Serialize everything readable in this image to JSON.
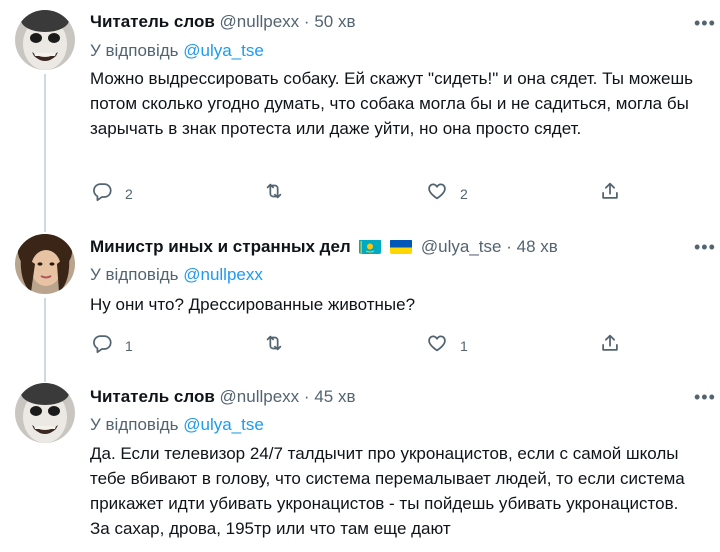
{
  "colors": {
    "link": "#1d9bf0",
    "secondary": "#536471",
    "text": "#0f1419",
    "thread_line": "#cfd9de"
  },
  "tweets": [
    {
      "name": "Читатель слов",
      "handle": "@nullpexx",
      "separator": "·",
      "time": "50 хв",
      "reply_prefix": "У відповідь",
      "reply_to": "@ulya_tse",
      "text": "Можно выдрессировать собаку. Ей скажут \"сидеть!\" и она сядет. Ты можешь потом сколько угодно думать, что собака могла бы и не садиться, могла бы зарычать в знак протеста или даже уйти, но она просто сядет.",
      "replies": "2",
      "retweets": "",
      "likes": "2"
    },
    {
      "name": "Министр иных и странных дел",
      "flags": [
        "kazakhstan-flag",
        "ukraine-flag"
      ],
      "handle": "@ulya_tse",
      "separator": "·",
      "time": "48 хв",
      "reply_prefix": "У відповідь",
      "reply_to": "@nullpexx",
      "text": "Ну они что? Дрессированные животные?",
      "replies": "1",
      "retweets": "",
      "likes": "1"
    },
    {
      "name": "Читатель слов",
      "handle": "@nullpexx",
      "separator": "·",
      "time": "45 хв",
      "reply_prefix": "У відповідь",
      "reply_to": "@ulya_tse",
      "text": "Да. Если телевизор 24/7 талдычит про укронацистов, если с самой школы тебе вбивают в голову, что система перемалывает людей, то если система прикажет идти убивать укронацистов - ты пойдешь убивать укронацистов. За сахар, дрова, 195тр или что там еще дают"
    }
  ]
}
